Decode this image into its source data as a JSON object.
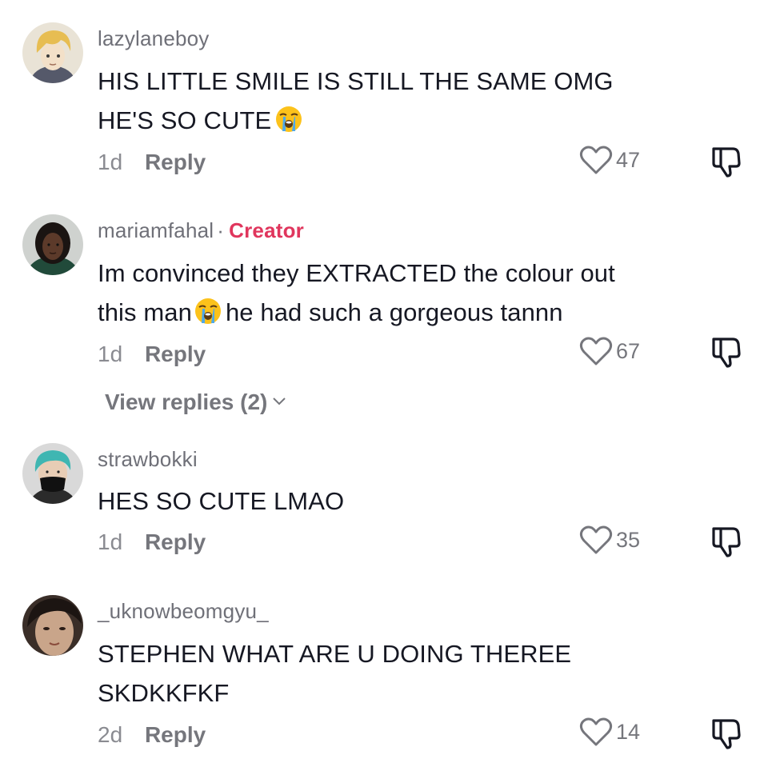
{
  "colors": {
    "text": "#161823",
    "muted": "#6f7078",
    "creator": "#e0365d",
    "icon": "#75767c"
  },
  "reply_label": "Reply",
  "comments": [
    {
      "username": "lazylaneboy",
      "creator": false,
      "text_line1": "HIS LITTLE SMILE IS STILL THE SAME OMG",
      "text_line2": "HE'S SO CUTE",
      "emoji": "loudly-crying-face",
      "time": "1d",
      "likes": "47",
      "avatar": "anime-boy-blonde"
    },
    {
      "username": "mariamfahal",
      "creator": true,
      "creator_dot": "·",
      "creator_label": "Creator",
      "text_line1": "Im convinced they EXTRACTED the colour out",
      "text_line2a": "this man",
      "text_line2b": "he had such a gorgeous tannn",
      "emoji": "loudly-crying-face",
      "time": "1d",
      "likes": "67",
      "view_replies": "View replies (2)",
      "avatar": "woman-dark-hair"
    },
    {
      "username": "strawbokki",
      "creator": false,
      "text_line1": "HES SO CUTE LMAO",
      "time": "1d",
      "likes": "35",
      "avatar": "teal-hair-mask"
    },
    {
      "username": "_uknowbeomgyu_",
      "creator": false,
      "text_line1": "STEPHEN WHAT ARE U DOING THEREE",
      "text_line2": "SKDKKFKF",
      "time": "2d",
      "likes": "14",
      "avatar": "person-closeup"
    }
  ]
}
